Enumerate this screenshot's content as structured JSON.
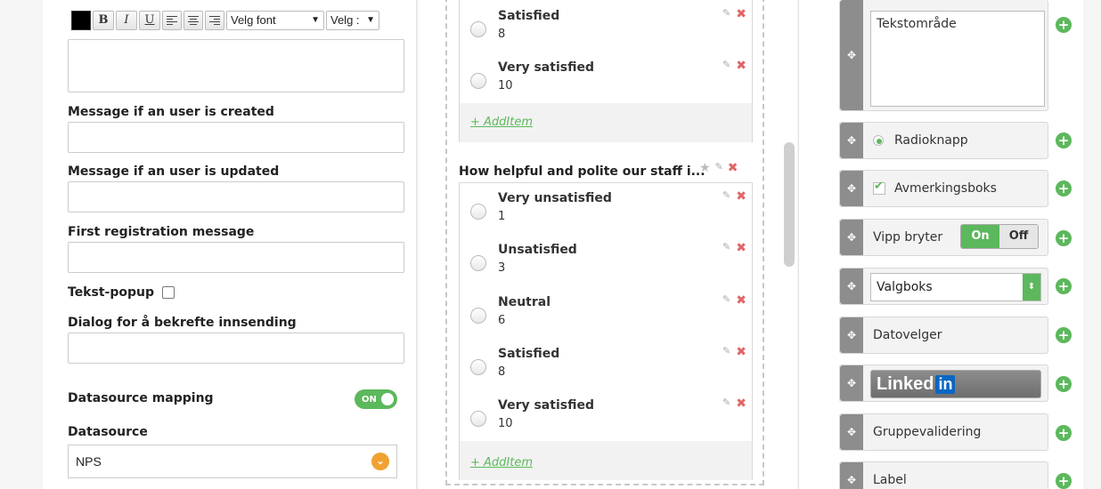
{
  "toolbar": {
    "bold": "B",
    "italic": "I",
    "underline": "U",
    "font_select": "Velg font",
    "size_select": "Velg :"
  },
  "left": {
    "msg_created": "Message if an user is created",
    "msg_updated": "Message if an user is updated",
    "first_registration": "First registration message",
    "text_popup": "Tekst-popup",
    "confirm_dialog": "Dialog for å bekrefte innsending",
    "datasource_mapping": "Datasource mapping",
    "toggle_label": "ON",
    "datasource": "Datasource",
    "datasource_value": "NPS"
  },
  "middle": {
    "top_group": [
      {
        "label": "Satisfied",
        "value": "8"
      },
      {
        "label": "Very satisfied",
        "value": "10"
      }
    ],
    "add_item": "+ AddItem",
    "question": "How helpful and polite our staff i...",
    "options": [
      {
        "label": "Very unsatisfied",
        "value": "1"
      },
      {
        "label": "Unsatisfied",
        "value": "3"
      },
      {
        "label": "Neutral",
        "value": "6"
      },
      {
        "label": "Satisfied",
        "value": "8"
      },
      {
        "label": "Very satisfied",
        "value": "10"
      }
    ]
  },
  "right": {
    "textarea": "Tekstområde",
    "radio": "Radioknapp",
    "checkbox": "Avmerkingsboks",
    "toggle_switch": "Vipp bryter",
    "switch_on": "On",
    "switch_off": "Off",
    "select": "Valgboks",
    "date_picker": "Datovelger",
    "linkedin_text": "Linked",
    "linkedin_in": "in",
    "group_validation": "Gruppevalidering",
    "label": "Label"
  },
  "colors": {
    "accent_green": "#5cb85c",
    "delete_red": "#e06666",
    "orange": "#f0a132"
  }
}
